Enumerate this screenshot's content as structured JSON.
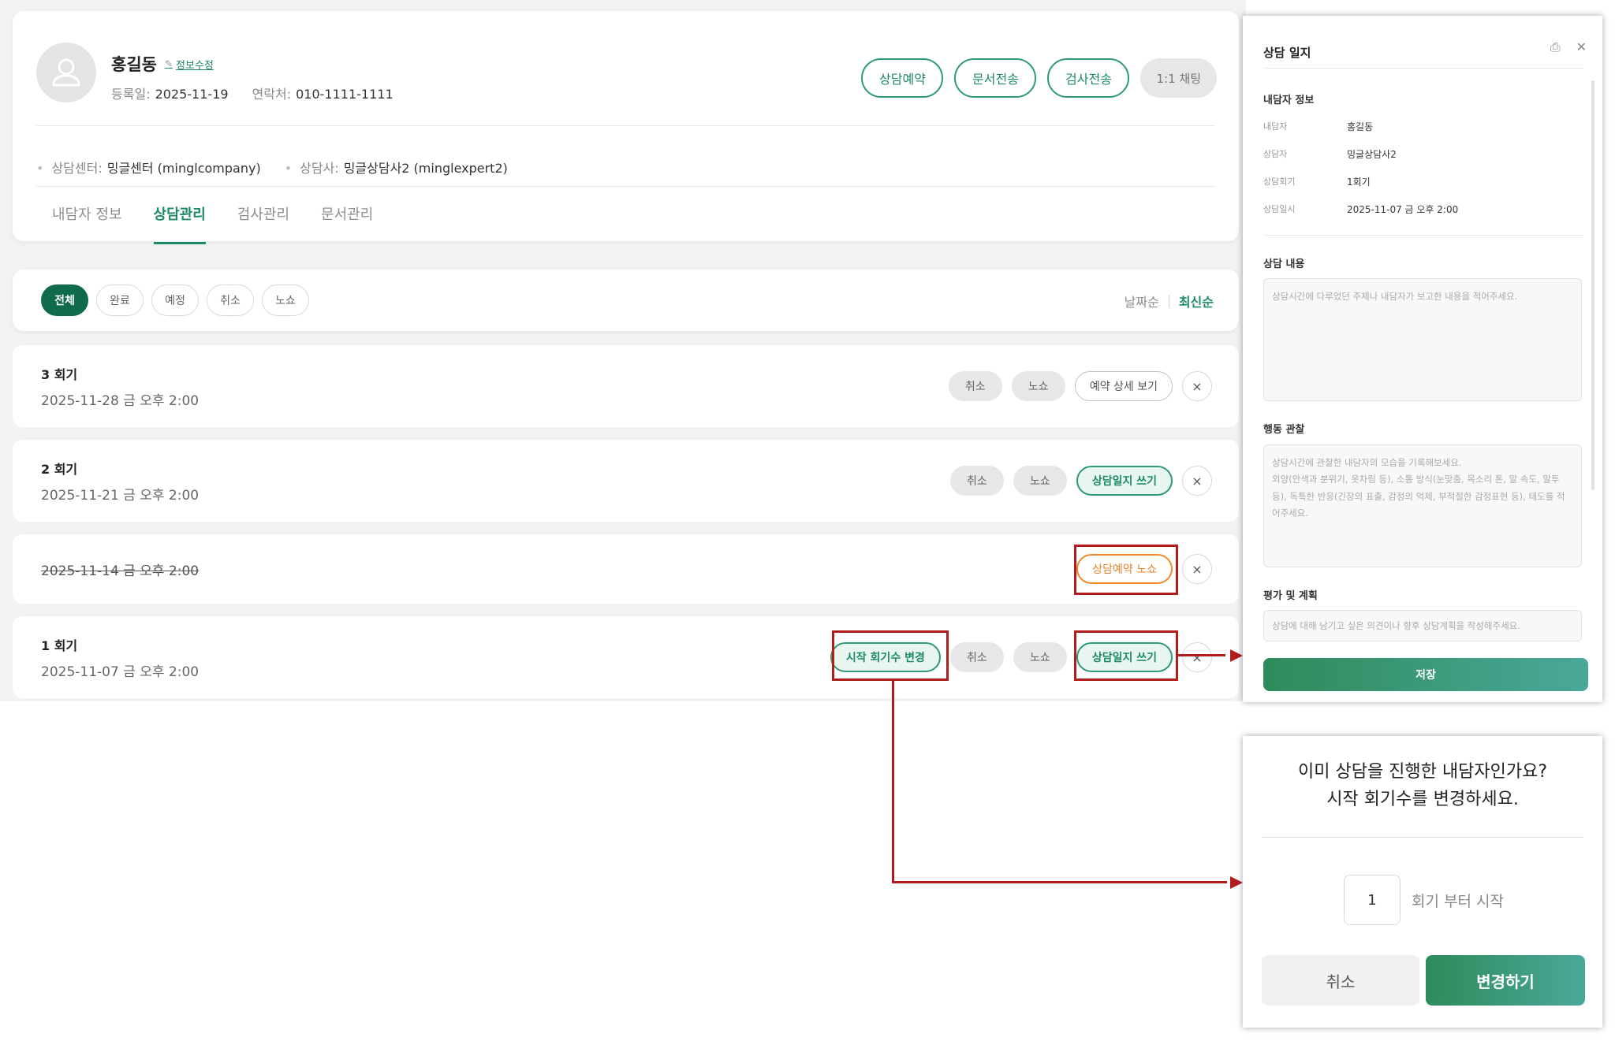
{
  "profile": {
    "name": "홍길동",
    "edit_label": "정보수정",
    "registered_label": "등록일:",
    "registered_value": "2025-11-19",
    "contact_label": "연락처:",
    "contact_value": "010-1111-1111",
    "actions": [
      "상담예약",
      "문서전송",
      "검사전송"
    ],
    "chat_label": "1:1 채팅",
    "center_label": "상담센터:",
    "center_value": "밍글센터 (minglcompany)",
    "counselor_label": "상담사:",
    "counselor_value": "밍글상담사2 (minglexpert2)",
    "tabs": [
      "내담자 정보",
      "상담관리",
      "검사관리",
      "문서관리"
    ],
    "active_tab": "상담관리"
  },
  "filters": {
    "chips": [
      "전체",
      "완료",
      "예정",
      "취소",
      "노쇼"
    ],
    "active": "전체",
    "sort_date": "날짜순",
    "sort_latest": "최신순"
  },
  "sessions": [
    {
      "title": "3 회기",
      "date": "2025-11-28 금 오후 2:00",
      "cancel": "취소",
      "noshow": "노쇼",
      "detail": "예약 상세 보기",
      "close": "×"
    },
    {
      "title": "2 회기",
      "date": "2025-11-21 금 오후 2:00",
      "cancel": "취소",
      "noshow": "노쇼",
      "write": "상담일지 쓰기",
      "close": "×"
    },
    {
      "date": "2025-11-14 금 오후 2:00",
      "status": "상담예약 노쇼",
      "close": "×"
    },
    {
      "title": "1 회기",
      "date": "2025-11-07 금 오후 2:00",
      "change": "시작 회기수 변경",
      "cancel": "취소",
      "noshow": "노쇼",
      "write": "상담일지 쓰기",
      "close": "×"
    }
  ],
  "panel": {
    "title": "상담 일지",
    "section_info": "내담자 정보",
    "fields": [
      {
        "k": "내담자",
        "v": "홍길동"
      },
      {
        "k": "상담자",
        "v": "밍글상담사2"
      },
      {
        "k": "상담회기",
        "v": "1회기"
      },
      {
        "k": "상담일시",
        "v": "2025-11-07 금 오후 2:00"
      }
    ],
    "section_content": "상담 내용",
    "content_placeholder": "상담시간에 다루었던 주제나 내담자가 보고한 내용을 적어주세요.",
    "section_behavior": "행동 관찰",
    "behavior_placeholder": "상담시간에 관찰한 내담자의 모습을 기록해보세요.\n외양(안색과 분위기, 옷차림 등), 소통 방식(눈맞춤, 목소리 톤, 말 속도, 말투 등), 독특한 반응(긴장의 표출, 감정의 억제, 부적절한 감정표현 등), 태도를 적어주세요.",
    "section_plan": "평가 및 계획",
    "plan_placeholder": "상담에 대해 남기고 싶은 의견이나 향후 상담계획을 작성해주세요.",
    "save_label": "저장"
  },
  "dialog": {
    "line1": "이미 상담을 진행한 내담자인가요?",
    "line2": "시작 회기수를 변경하세요.",
    "value": "1",
    "suffix": "회기 부터 시작",
    "cancel_label": "취소",
    "confirm_label": "변경하기"
  },
  "colors": {
    "primary": "#1d8a64",
    "primary_dark": "#0f6b4c",
    "noshow_orange": "#f08a2b",
    "annotation_red": "#b11c1c"
  },
  "icons": [
    "user-avatar-icon",
    "pencil-icon",
    "print-icon",
    "close-icon"
  ]
}
